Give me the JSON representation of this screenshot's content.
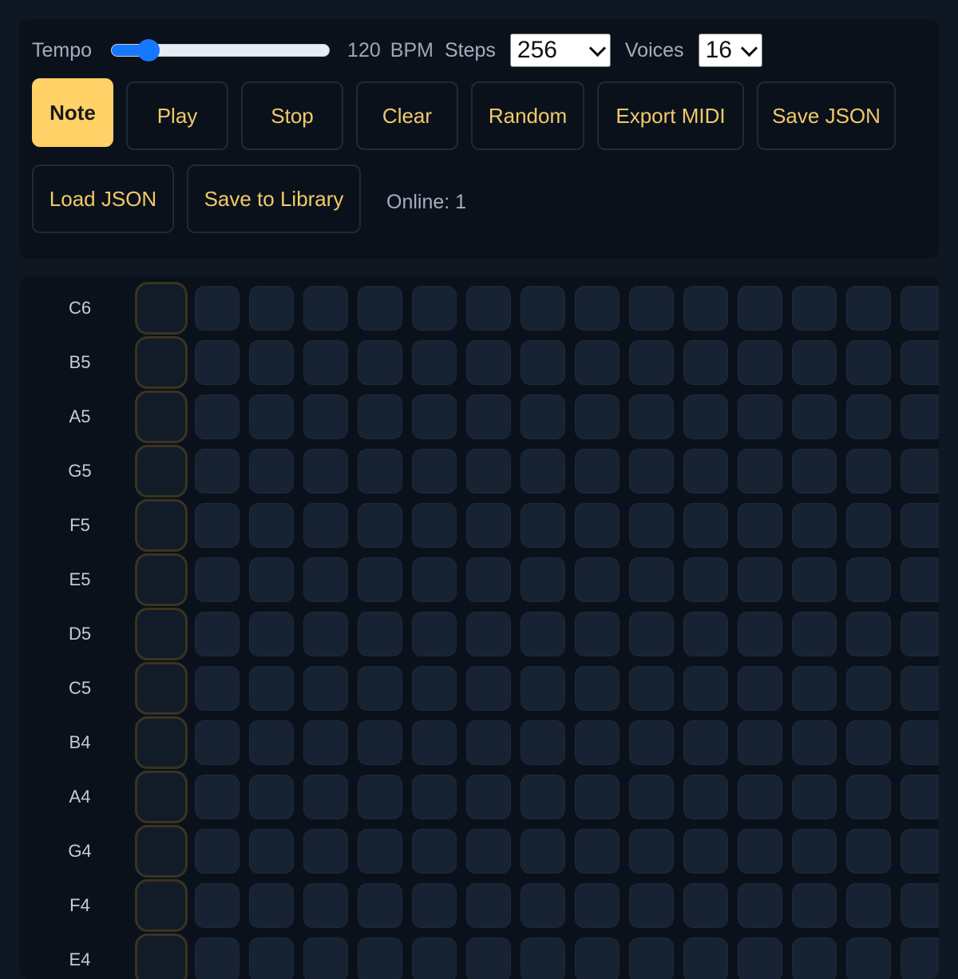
{
  "controls": {
    "tempo_label": "Tempo",
    "tempo_value": "120",
    "tempo_unit": "BPM",
    "tempo_fraction": 0.125,
    "steps_label": "Steps",
    "steps_value": "256",
    "voices_label": "Voices",
    "voices_value": "16"
  },
  "buttons": [
    {
      "id": "note",
      "label": "Note",
      "active": true
    },
    {
      "id": "play",
      "label": "Play",
      "active": false
    },
    {
      "id": "stop",
      "label": "Stop",
      "active": false
    },
    {
      "id": "clear",
      "label": "Clear",
      "active": false
    },
    {
      "id": "random",
      "label": "Random",
      "active": false
    },
    {
      "id": "export-midi",
      "label": "Export MIDI",
      "active": false
    },
    {
      "id": "save-json",
      "label": "Save JSON",
      "active": false
    },
    {
      "id": "load-json",
      "label": "Load JSON",
      "active": false
    },
    {
      "id": "save-to-library",
      "label": "Save to Library",
      "active": false
    }
  ],
  "status": {
    "online": "Online: 1"
  },
  "sequencer": {
    "notes": [
      "C6",
      "B5",
      "A5",
      "G5",
      "F5",
      "E5",
      "D5",
      "C5",
      "B4",
      "A4",
      "G4",
      "F4",
      "E4"
    ],
    "playhead_step": 0
  }
}
